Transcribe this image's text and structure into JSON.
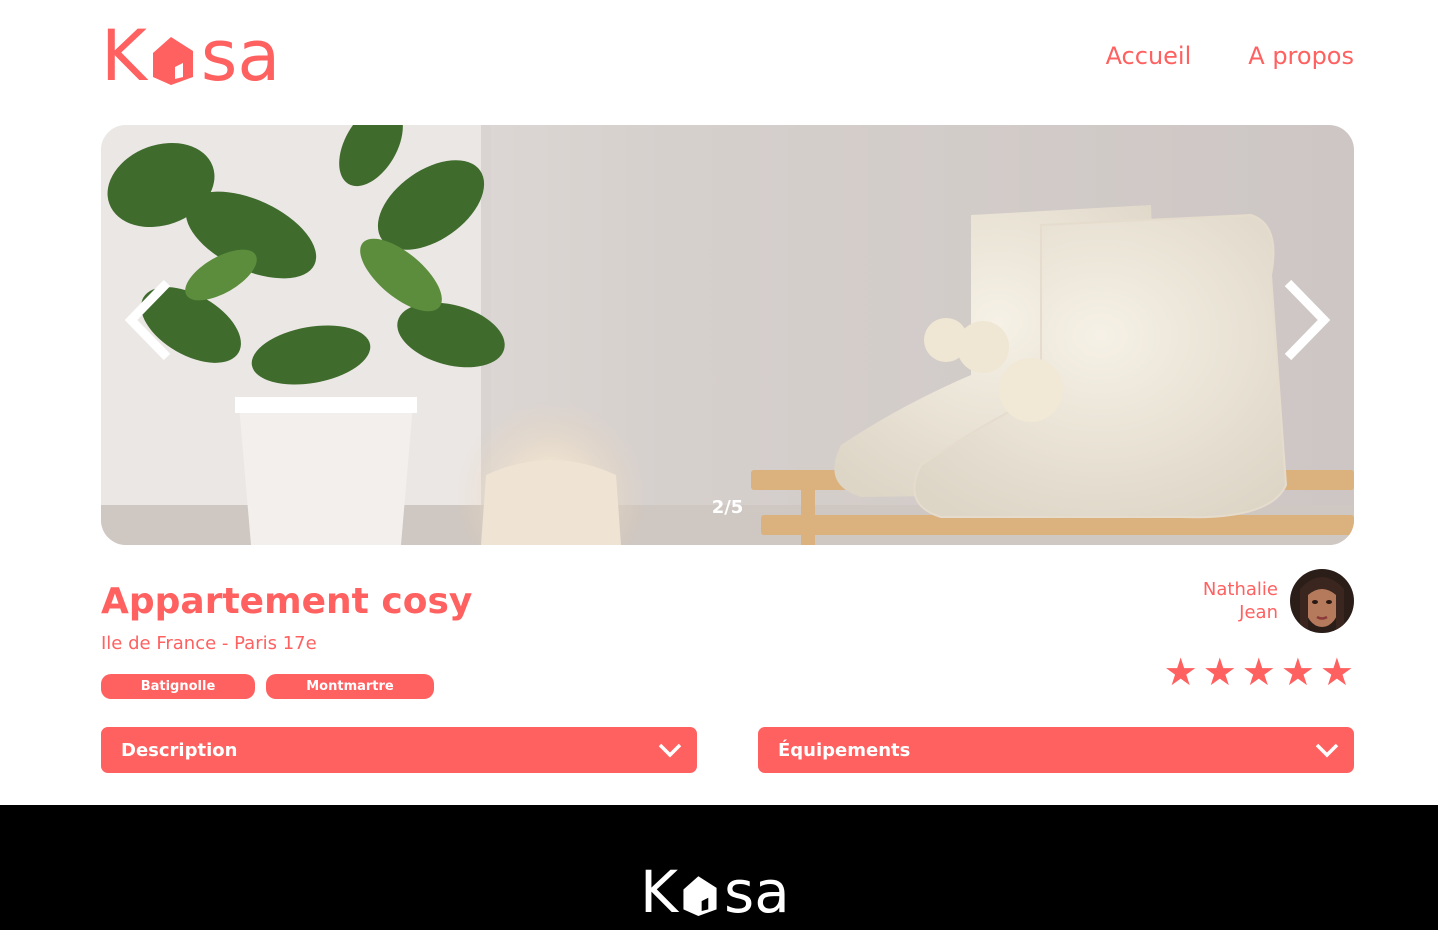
{
  "brand": {
    "logo_first": "K",
    "logo_rest": "sa",
    "color": "#FF6060"
  },
  "nav": {
    "home": "Accueil",
    "about": "A propos"
  },
  "carousel": {
    "counter": "2/5",
    "prev_icon": "chevron-left-icon",
    "next_icon": "chevron-right-icon"
  },
  "listing": {
    "title": "Appartement cosy",
    "location": "Ile de France - Paris 17e",
    "tags": [
      "Batignolle",
      "Montmartre"
    ]
  },
  "host": {
    "first_name": "Nathalie",
    "last_name": "Jean"
  },
  "rating": {
    "value": 5,
    "max": 5,
    "stars": [
      "★",
      "★",
      "★",
      "★",
      "★"
    ]
  },
  "collapses": {
    "description": "Description",
    "equipment": "Équipements",
    "icon": "chevron-down-icon"
  },
  "footer": {
    "logo_first": "K",
    "logo_rest": "sa"
  }
}
